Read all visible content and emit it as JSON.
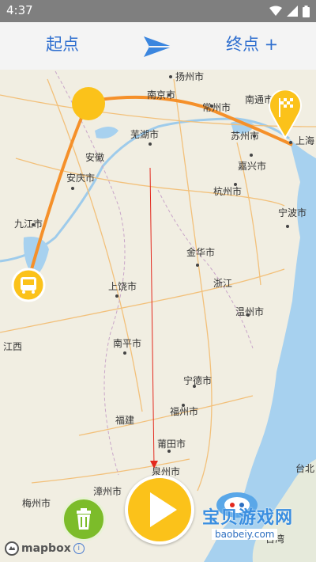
{
  "status_bar": {
    "time": "4:37",
    "icons": [
      "wifi-icon",
      "signal-icon",
      "battery-icon"
    ]
  },
  "toolbar": {
    "start_label": "起点",
    "end_label": "终点 +",
    "arrow_icon": "send-arrow-icon",
    "accent_color": "#2f6fcf"
  },
  "map": {
    "place_labels": [
      "扬州市",
      "南京市",
      "常州市",
      "南通市",
      "芜湖市",
      "苏州市",
      "上海",
      "安徽",
      "嘉兴市",
      "安庆市",
      "杭州市",
      "九江市",
      "宁波市",
      "金华市",
      "浙江",
      "上饶市",
      "温州市",
      "南平市",
      "江西",
      "宁德市",
      "福州市",
      "福建",
      "莆田市",
      "泉州市",
      "漳州市",
      "梅州市",
      "台北",
      "台湾"
    ],
    "route_color": "#f5902a",
    "marker_colors": {
      "start": "#fbc21a",
      "bus": "#fbc21a",
      "flag": "#fbc21a"
    },
    "markers": {
      "start": "start-marker",
      "bus": "bus-icon",
      "flag": "checkered-flag-icon"
    }
  },
  "controls": {
    "trash_icon": "trash-icon",
    "play_icon": "play-icon"
  },
  "attribution": {
    "brand": "mapbox",
    "info": "i"
  },
  "watermark": {
    "text": "宝贝游戏网",
    "url": "baobeiy.com"
  }
}
